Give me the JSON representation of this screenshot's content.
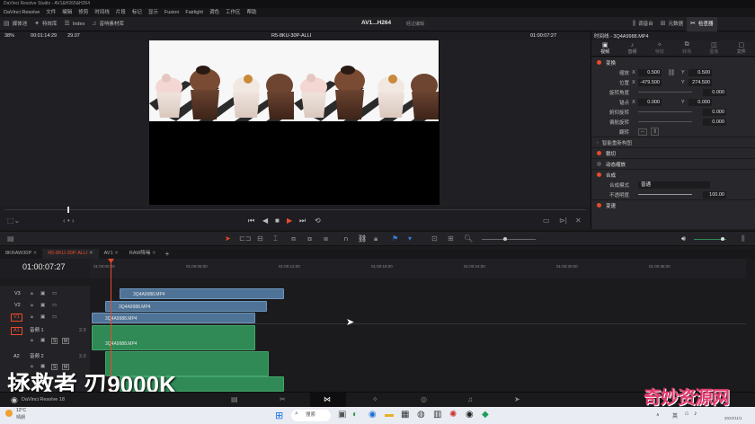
{
  "window": {
    "title": "DaVinci Resolve Studio - AV1&H265&H264"
  },
  "menu": [
    "DaVinci Resolve",
    "文件",
    "编辑",
    "修剪",
    "时间线",
    "片段",
    "标记",
    "显示",
    "Fusion",
    "Fairlight",
    "调色",
    "工作区",
    "帮助"
  ],
  "toolbar": {
    "media_pool": "媒体池",
    "effects": "特效库",
    "edit_index": "Index",
    "sound_lib": "音响素材库",
    "project_name": "AV1...H264",
    "project_status": "经过编辑",
    "mixer": "调音台",
    "metadata": "元数据",
    "inspector": "检查器"
  },
  "viewer": {
    "zoom": "38%",
    "timecode_left": "00:01:14:29",
    "fps": "29.07",
    "clip_name": "R5-8KU-30P-ALLI",
    "timecode_right": "01:00:07:27"
  },
  "inspector": {
    "header": "时间线 - 3Q4A9988.MP4",
    "tabs": [
      "视频",
      "音频",
      "特效",
      "转场",
      "图像",
      "文件"
    ],
    "sections": {
      "transform": "变换",
      "zoom_label": "缩放",
      "zoom_x": "0.500",
      "zoom_y": "0.500",
      "position_label": "位置",
      "position_x": "-479.500",
      "position_y": "274.500",
      "rotation_label": "旋转角度",
      "rotation_value": "0.000",
      "anchor_label": "锚点",
      "anchor_x": "0.000",
      "anchor_y": "0.000",
      "pitch_label": "俯仰旋转",
      "pitch_value": "0.000",
      "yaw_label": "偏航旋转",
      "yaw_value": "0.000",
      "flip_label": "翻转",
      "smart_reframe": "智能重新构图",
      "crop": "裁切",
      "dynamic_zoom": "动态缩放",
      "composite": "合成",
      "composite_mode_label": "合成模式",
      "composite_mode_value": "普通",
      "opacity_label": "不透明度",
      "opacity_value": "100.00",
      "speed": "变速"
    }
  },
  "timeline_tabs": [
    "8KRAW30P",
    "R5-8KU-30P-ALLI",
    "AV1",
    "RAW降噪"
  ],
  "timeline": {
    "current_timecode": "01:00:07:27",
    "ruler_marks": [
      "01:00:00:00",
      "01:00:06:00",
      "01:00:12:00",
      "01:00:18:00",
      "01:00:24:00",
      "01:00:30:00",
      "01:00:36:00"
    ],
    "tracks": [
      {
        "id": "V3",
        "clip": "3Q4A9988.MP4"
      },
      {
        "id": "V2",
        "clip": "3Q4A9988.MP4"
      },
      {
        "id": "V1",
        "clip": "3Q4A9988.MP4"
      },
      {
        "id": "A1",
        "name": "音频 1",
        "level": "2.0",
        "clip": "3Q4A9988.MP4"
      },
      {
        "id": "A2",
        "name": "音频 2",
        "level": "2.0"
      }
    ]
  },
  "overlay_caption": "拯救者 刃9000K",
  "watermark": "奇妙资源网",
  "status": {
    "app_version": "DaVinci Resolve 18"
  },
  "taskbar": {
    "weather_temp": "12°C",
    "weather_desc": "晴朗",
    "search": "搜索",
    "ime_lang": "英",
    "date": "2022/11/1"
  },
  "colors": {
    "accent": "#e74b2c",
    "video_clip": "#4f7396",
    "audio_clip": "#2f8a55",
    "playhead": "#e74b2c"
  }
}
